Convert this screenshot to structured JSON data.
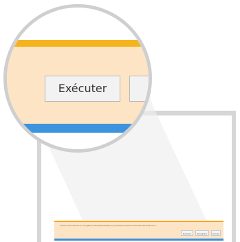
{
  "magnifier": {
    "run_button_label": "Exécuter"
  },
  "download_bar": {
    "message": "Voulez-vous exécuter ou enregistrer SetupDownloader.exe (1,5 Mo) à partir de download.microsoft.com ?",
    "buttons": [
      "Exécuter",
      "Enregistrer",
      "Annuler"
    ]
  },
  "colors": {
    "bar_background": "#fde4c4",
    "bar_top_accent": "#f5b31f",
    "bar_bottom_accent": "#3d93de",
    "window_frame": "#d6d6d6",
    "magnifier_ring": "#cfcfcf"
  }
}
